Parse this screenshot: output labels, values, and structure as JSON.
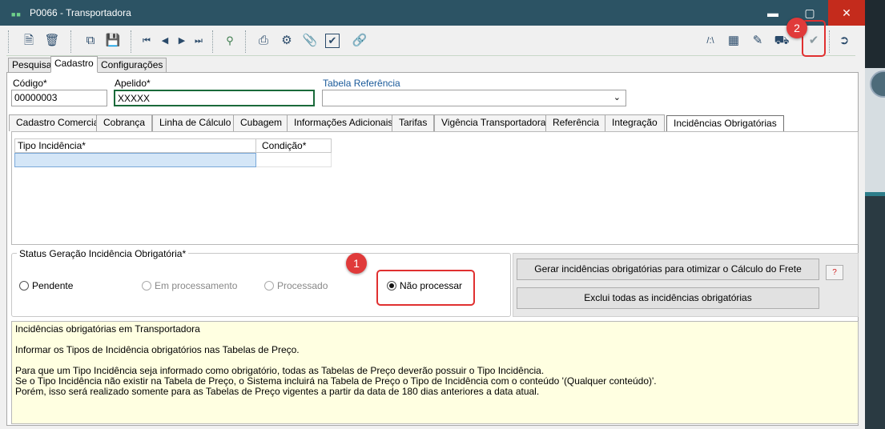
{
  "window": {
    "logo": "■■",
    "title": "P0066 - Transportadora",
    "min_icon": "minimize-icon",
    "max_icon": "maximize-icon",
    "close_icon": "close-icon"
  },
  "toolbar": {
    "left_icons": [
      "new-document-icon",
      "delete-icon",
      "copy-icon",
      "save-icon",
      "first-record-icon",
      "previous-record-icon",
      "next-record-icon",
      "last-record-icon",
      "search-record-icon",
      "print-icon",
      "settings-icon",
      "attach-icon",
      "check-icon",
      "link-icon"
    ],
    "right_icons": [
      "path-icon",
      "table-icon",
      "edit-icon",
      "truck-icon",
      "confirm-check-icon",
      "exit-icon"
    ]
  },
  "annotations": {
    "badge1": "1",
    "badge2": "2"
  },
  "main_tabs": [
    "Pesquisa",
    "Cadastro",
    "Configurações"
  ],
  "form": {
    "codigo_label": "Código*",
    "codigo_value": "00000003",
    "apelido_label": "Apelido*",
    "apelido_value": "XXXXX",
    "tabela_label": "Tabela Referência",
    "tabela_value": ""
  },
  "sub_tabs": [
    "Cadastro Comercial",
    "Cobrança",
    "Linha de Cálculo",
    "Cubagem",
    "Informações Adicionais",
    "Tarifas",
    "Vigência Transportadora",
    "Referência",
    "Integração",
    "Incidências Obrigatórias"
  ],
  "grid": {
    "col1": "Tipo Incidência*",
    "col2": "Condição*"
  },
  "status": {
    "title": "Status Geração Incidência Obrigatória*",
    "options": [
      "Pendente",
      "Em processamento",
      "Processado",
      "Não processar"
    ],
    "selected": "Não processar"
  },
  "buttons": {
    "gerar": "Gerar incidências obrigatórias para otimizar o Cálculo do Frete",
    "help": "?",
    "excluir": "Exclui todas as incidências obrigatórias"
  },
  "info": {
    "line1": "Incidências obrigatórias em Transportadora",
    "line2": "Informar os Tipos de Incidência obrigatórios nas Tabelas de Preço.",
    "line3": "Para que um Tipo Incidência seja informado como obrigatório, todas as Tabelas de Preço deverão possuir o Tipo Incidência.",
    "line4": "Se o Tipo Incidência não existir na Tabela de Preço, o Sistema incluirá na Tabela de Preço o Tipo de Incidência com o conteúdo '(Qualquer conteúdo)'.",
    "line5": "Porém, isso será realizado somente para as Tabelas de Preço vigentes a partir da data de 180 dias anteriores a data atual."
  }
}
